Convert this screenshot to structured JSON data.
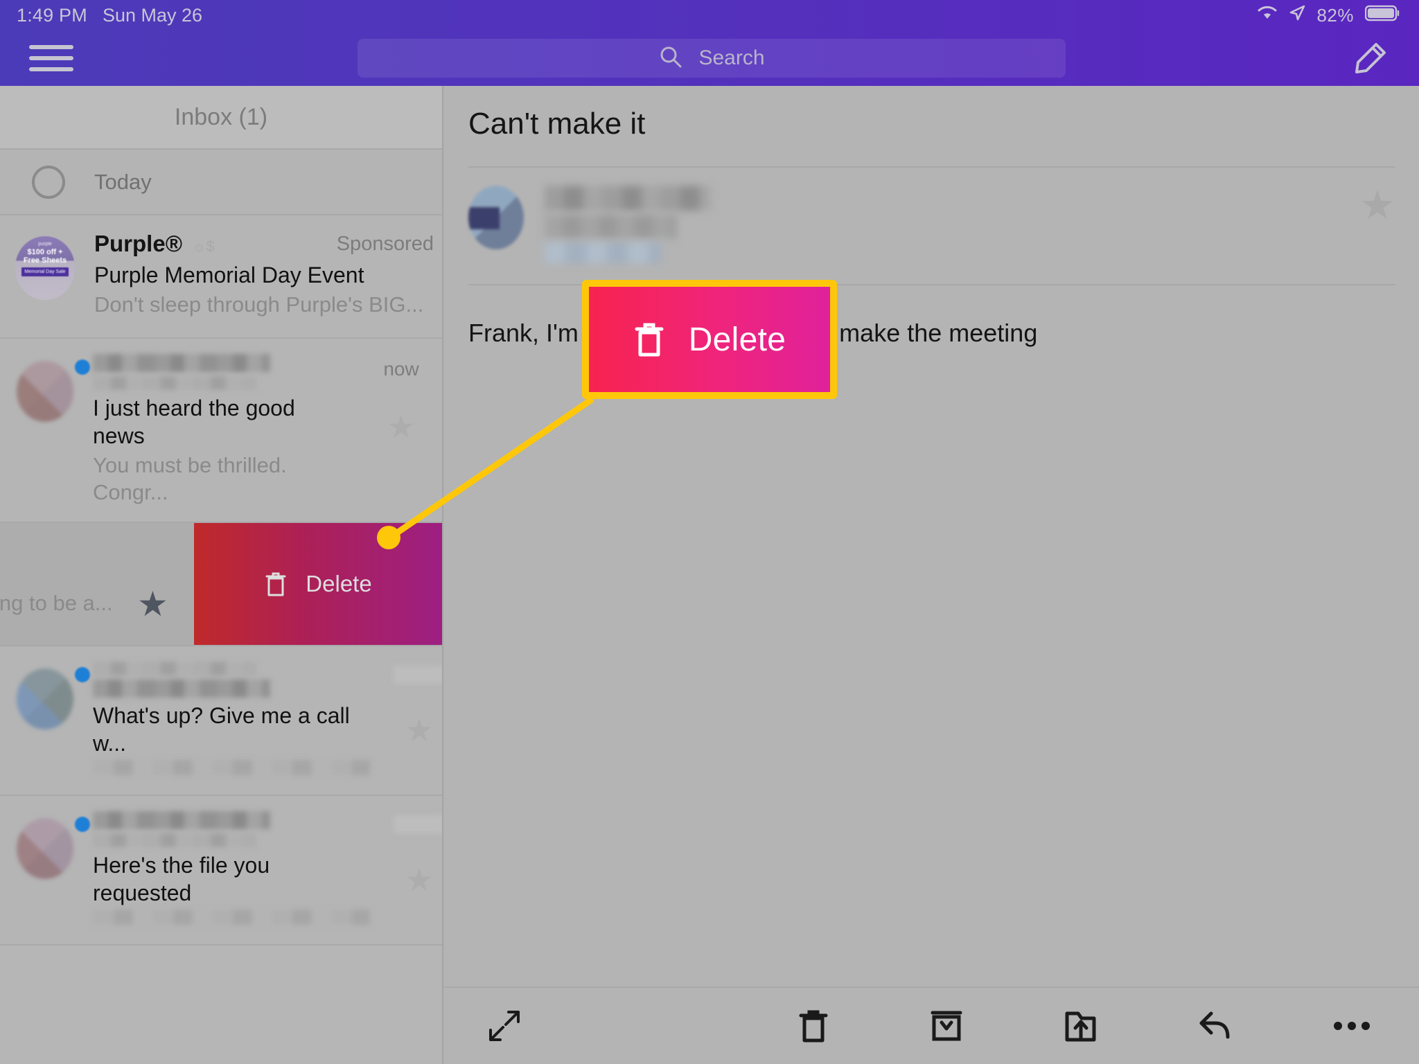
{
  "status_bar": {
    "time": "1:49 PM",
    "date": "Sun May 26",
    "battery_percent": "82%",
    "wifi_icon": "wifi-icon",
    "location_icon": "location-arrow-icon",
    "battery_icon": "battery-icon"
  },
  "app_bar": {
    "menu_icon": "hamburger-menu-icon",
    "search_placeholder": "Search",
    "search_icon": "search-icon",
    "compose_icon": "compose-pencil-icon"
  },
  "sidebar": {
    "title": "Inbox (1)",
    "section_label": "Today",
    "ad": {
      "sender": "Purple®",
      "badge_icon": "sun-dollar-icon",
      "label": "Sponsored",
      "subject": "Purple Memorial Day Event",
      "preview": "Don't sleep through Purple's BIG...",
      "avatar_top": "purple",
      "avatar_line1": "$100 off +",
      "avatar_line2": "Free Sheets",
      "avatar_badge": "Memorial Day Sale"
    },
    "messages": [
      {
        "subject": "I just heard the good news",
        "preview": "You must be thrilled. Congr...",
        "timestamp": "now",
        "unread": true,
        "starred": false
      },
      {
        "subject": "What's up? Give me a call w...",
        "preview": "",
        "timestamp": "",
        "unread": true,
        "starred": false
      },
      {
        "subject": "Here's the file you requested",
        "preview": "",
        "timestamp": "",
        "unread": true,
        "starred": false
      }
    ],
    "swiped_row": {
      "preview_fragment": "ing to be a...",
      "delete_label": "Delete",
      "trash_icon": "trash-icon",
      "starred": true
    }
  },
  "reader": {
    "subject": "Can't make it",
    "body": "Frank, I'm not going to be able to make the meeting",
    "body_visible_left": "Frank, I'm n",
    "body_visible_right": "e the meeting",
    "star_icon": "star-icon",
    "toolbar": {
      "expand_icon": "expand-arrows-icon",
      "delete_icon": "trash-icon",
      "archive_icon": "archive-icon",
      "move_icon": "move-to-folder-icon",
      "reply_icon": "reply-arrow-icon",
      "more_icon": "more-options-icon"
    }
  },
  "callout": {
    "label": "Delete",
    "trash_icon": "trash-icon",
    "border_color": "#ffc70a",
    "gradient_from": "#f7234f",
    "gradient_to": "#e0219b",
    "marker_icon": "callout-dot"
  },
  "colors": {
    "header_purple_left": "#4c3bb8",
    "header_purple_right": "#5a26c0",
    "unread_dot": "#1d7fd6",
    "swipe_red": "#bf2a2a",
    "swipe_magenta": "#9d1f82",
    "highlight_yellow": "#ffc70a"
  }
}
